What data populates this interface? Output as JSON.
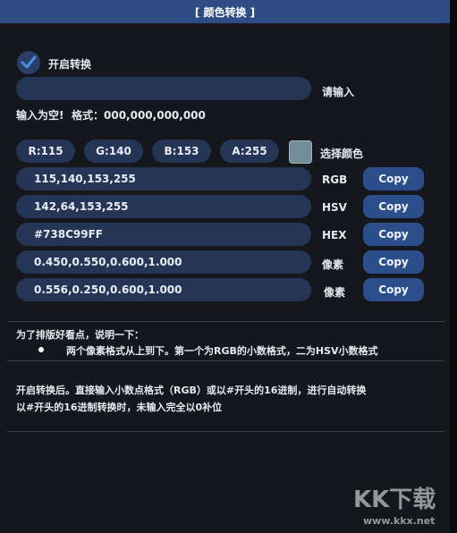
{
  "window": {
    "title": "[ 颜色转换 ]"
  },
  "convert_toggle": {
    "label": "开启转换",
    "checked": true
  },
  "input": {
    "value": "",
    "side_label": "请输入"
  },
  "status": {
    "message": "输入为空!",
    "format_hint": "格式：000,000,000,000"
  },
  "rgba_chips": {
    "r": "R:115",
    "g": "G:140",
    "b": "B:153",
    "a": "A:255"
  },
  "color_picker": {
    "label": "选择颜色",
    "color": "#738C99"
  },
  "rows": [
    {
      "value": "115,140,153,255",
      "label": "RGB",
      "button": "Copy"
    },
    {
      "value": "142,64,153,255",
      "label": "HSV",
      "button": "Copy"
    },
    {
      "value": "#738C99FF",
      "label": "HEX",
      "button": "Copy"
    },
    {
      "value": "0.450,0.550,0.600,1.000",
      "label": "像素",
      "button": "Copy"
    },
    {
      "value": "0.556,0.250,0.600,1.000",
      "label": "像素",
      "button": "Copy"
    }
  ],
  "notes": {
    "heading": "为了排版好看点，说明一下：",
    "bullet": "两个像素格式从上到下。第一个为RGB的小数格式，二为HSV小数格式",
    "line1": "开启转换后。直接输入小数点格式（RGB）或以#开头的16进制，进行自动转换",
    "line2": "以#开头的16进制转换时，未输入完全以0补位"
  },
  "watermark": {
    "brand": "KK下载",
    "url": "www.kkx.net"
  },
  "colors": {
    "titlebar": "#2e4d86",
    "background": "#15171c",
    "field": "#243556",
    "copy_button": "#2c4f8c",
    "check": "#4a8fe6"
  }
}
